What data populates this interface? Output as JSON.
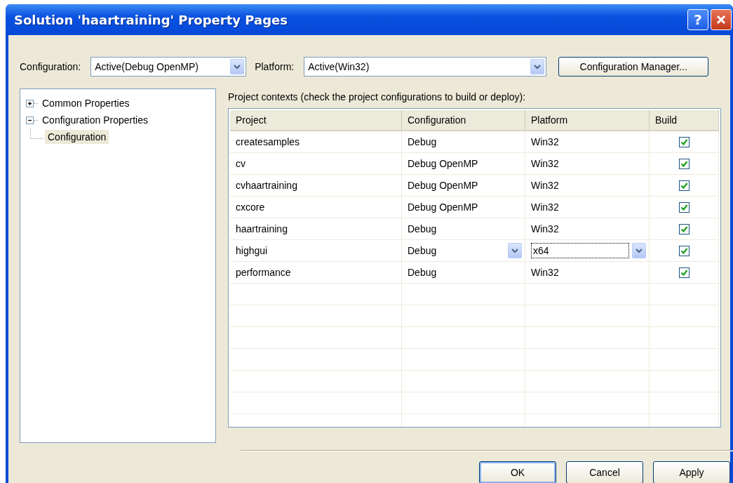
{
  "window": {
    "title": "Solution 'haartraining' Property Pages",
    "help_button": "?"
  },
  "toolbar": {
    "configuration_label": "Configuration:",
    "configuration_value": "Active(Debug OpenMP)",
    "platform_label": "Platform:",
    "platform_value": "Active(Win32)",
    "manager_button": "Configuration Manager..."
  },
  "tree": [
    {
      "label": "Common Properties",
      "expanded": false,
      "selected": false
    },
    {
      "label": "Configuration Properties",
      "expanded": true,
      "selected": false,
      "children": [
        {
          "label": "Configuration",
          "selected": true
        }
      ]
    }
  ],
  "grid": {
    "caption": "Project contexts (check the project configurations to build or deploy):",
    "columns": [
      "Project",
      "Configuration",
      "Platform",
      "Build"
    ],
    "rows": [
      {
        "project": "createsamples",
        "configuration": "Debug",
        "platform": "Win32",
        "build": true,
        "editing": false
      },
      {
        "project": "cv",
        "configuration": "Debug OpenMP",
        "platform": "Win32",
        "build": true,
        "editing": false
      },
      {
        "project": "cvhaartraining",
        "configuration": "Debug OpenMP",
        "platform": "Win32",
        "build": true,
        "editing": false
      },
      {
        "project": "cxcore",
        "configuration": "Debug OpenMP",
        "platform": "Win32",
        "build": true,
        "editing": false
      },
      {
        "project": "haartraining",
        "configuration": "Debug",
        "platform": "Win32",
        "build": true,
        "editing": false
      },
      {
        "project": "highgui",
        "configuration": "Debug",
        "platform": "x64",
        "build": true,
        "editing": true
      },
      {
        "project": "performance",
        "configuration": "Debug",
        "platform": "Win32",
        "build": true,
        "editing": false
      }
    ]
  },
  "buttons": [
    {
      "label": "OK",
      "default": true
    },
    {
      "label": "Cancel",
      "default": false
    },
    {
      "label": "Apply",
      "default": false
    }
  ]
}
